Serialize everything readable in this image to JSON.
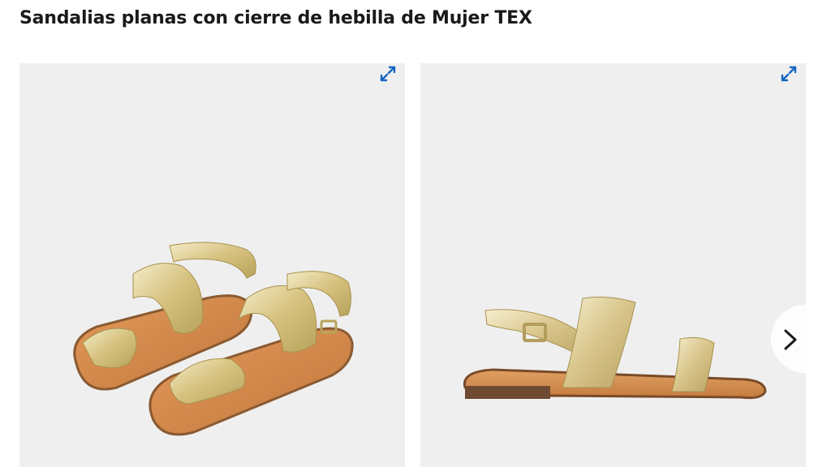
{
  "product": {
    "title": "Sandalias planas con cierre de hebilla de Mujer TEX"
  },
  "gallery": {
    "images": [
      {
        "expand_icon": "expand-arrows-icon"
      },
      {
        "expand_icon": "expand-arrows-icon"
      }
    ],
    "next_icon": "chevron-right-icon"
  },
  "colors": {
    "accent": "#1565c0",
    "panel_bg": "#efefef",
    "gold": "#d8c88a",
    "sole": "#d08a4e"
  }
}
